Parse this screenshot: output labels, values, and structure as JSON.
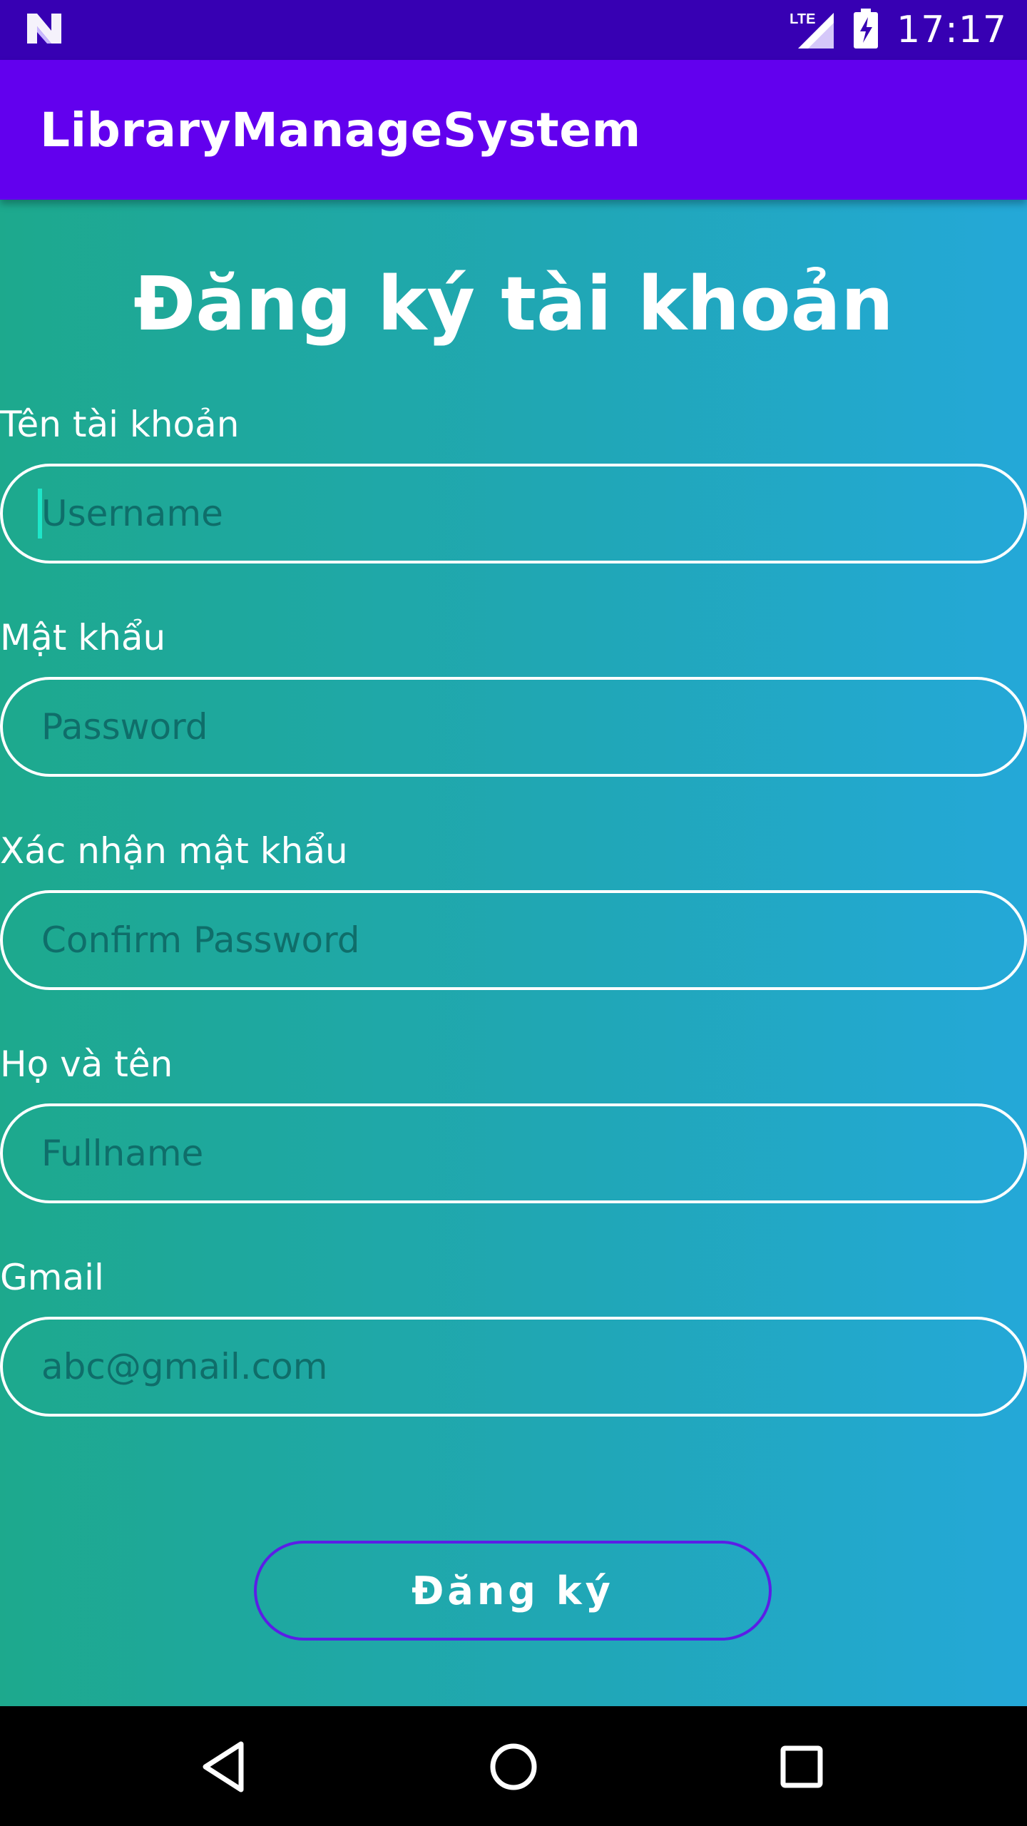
{
  "status_bar": {
    "time": "17:17",
    "network_label": "LTE",
    "icons": [
      "android-n-icon",
      "lte-signal-icon",
      "battery-charging-icon"
    ]
  },
  "app_bar": {
    "title": "LibraryManageSystem"
  },
  "form": {
    "title": "Đăng ký tài khoản",
    "fields": [
      {
        "label": "Tên tài khoản",
        "placeholder": "Username",
        "value": ""
      },
      {
        "label": "Mật khẩu",
        "placeholder": "Password",
        "value": ""
      },
      {
        "label": "Xác nhận mật khẩu",
        "placeholder": "Confirm Password",
        "value": ""
      },
      {
        "label": "Họ và tên",
        "placeholder": "Fullname",
        "value": ""
      },
      {
        "label": "Gmail",
        "placeholder": "abc@gmail.com",
        "value": ""
      }
    ],
    "submit_label": "Đăng ký"
  },
  "nav_bar": {
    "icons": [
      "back-icon",
      "home-icon",
      "recents-icon"
    ]
  },
  "colors": {
    "status_bar": "#3700b3",
    "app_bar": "#6200ee",
    "gradient_start": "#1da98d",
    "gradient_end": "#24a8d8",
    "button_border": "#5b1ee6"
  }
}
